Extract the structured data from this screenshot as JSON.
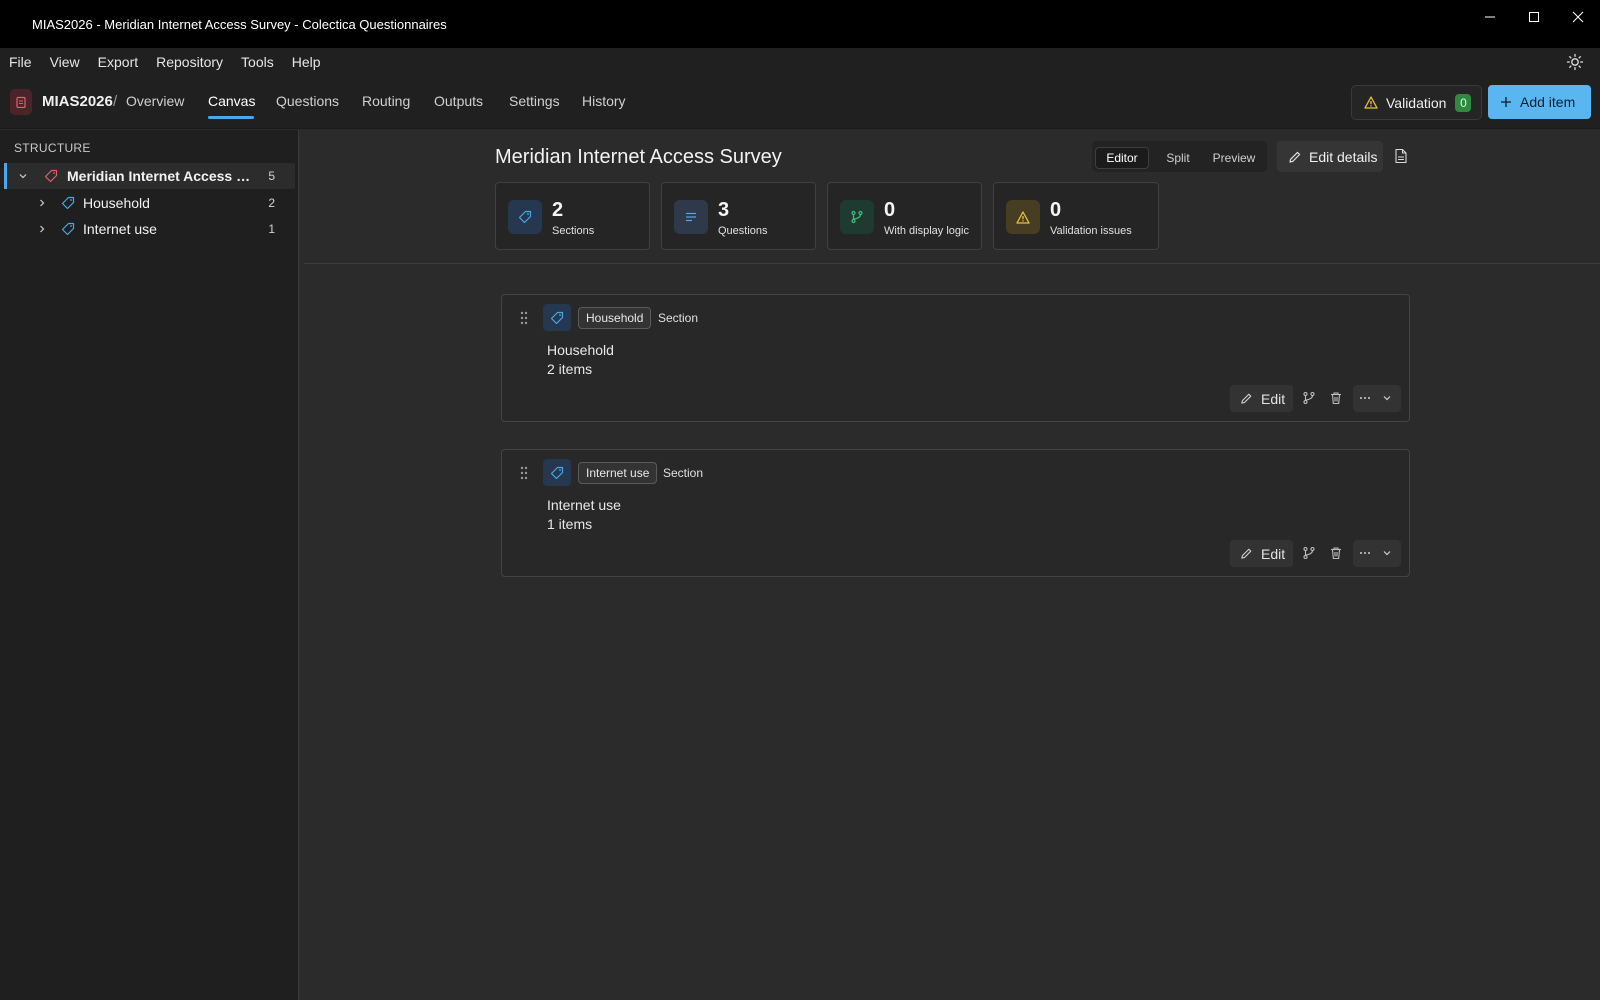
{
  "window": {
    "title": "MIAS2026 - Meridian Internet Access Survey - Colectica Questionnaires"
  },
  "menu": {
    "items": [
      "File",
      "View",
      "Export",
      "Repository",
      "Tools",
      "Help"
    ]
  },
  "nav": {
    "project": "MIAS2026",
    "separator": "/",
    "tabs": [
      "Overview",
      "Canvas",
      "Questions",
      "Routing",
      "Outputs",
      "Settings",
      "History"
    ],
    "active_tab": "Canvas",
    "validation_label": "Validation",
    "validation_count": "0",
    "add_item_label": "Add item"
  },
  "sidebar": {
    "title": "STRUCTURE",
    "root": {
      "label": "Meridian Internet Access Su...",
      "count": "5"
    },
    "children": [
      {
        "label": "Household",
        "count": "2"
      },
      {
        "label": "Internet use",
        "count": "1"
      }
    ]
  },
  "main": {
    "survey_title": "Meridian Internet Access Survey",
    "view_modes": [
      "Editor",
      "Split",
      "Preview"
    ],
    "active_view": "Editor",
    "edit_details_label": "Edit details",
    "stats": [
      {
        "value": "2",
        "label": "Sections",
        "icon": "tag-icon",
        "color": "#25384f"
      },
      {
        "value": "3",
        "label": "Questions",
        "icon": "lines-icon",
        "color": "#2e3a4a"
      },
      {
        "value": "0",
        "label": "With display logic",
        "icon": "branch-icon",
        "color": "#1f3a30"
      },
      {
        "value": "0",
        "label": "Validation issues",
        "icon": "warning-icon",
        "color": "#473d22"
      }
    ],
    "sections": [
      {
        "chip": "Household",
        "type": "Section",
        "name": "Household",
        "count_text": "2  items",
        "edit_label": "Edit"
      },
      {
        "chip": "Internet use",
        "type": "Section",
        "name": "Internet use",
        "count_text": "1  items",
        "edit_label": "Edit"
      }
    ]
  },
  "colors": {
    "accent": "#4aa8e8",
    "add_button": "#5ab6f0",
    "badge_green": "#2e8b3e",
    "warning": "#e8c33a"
  }
}
